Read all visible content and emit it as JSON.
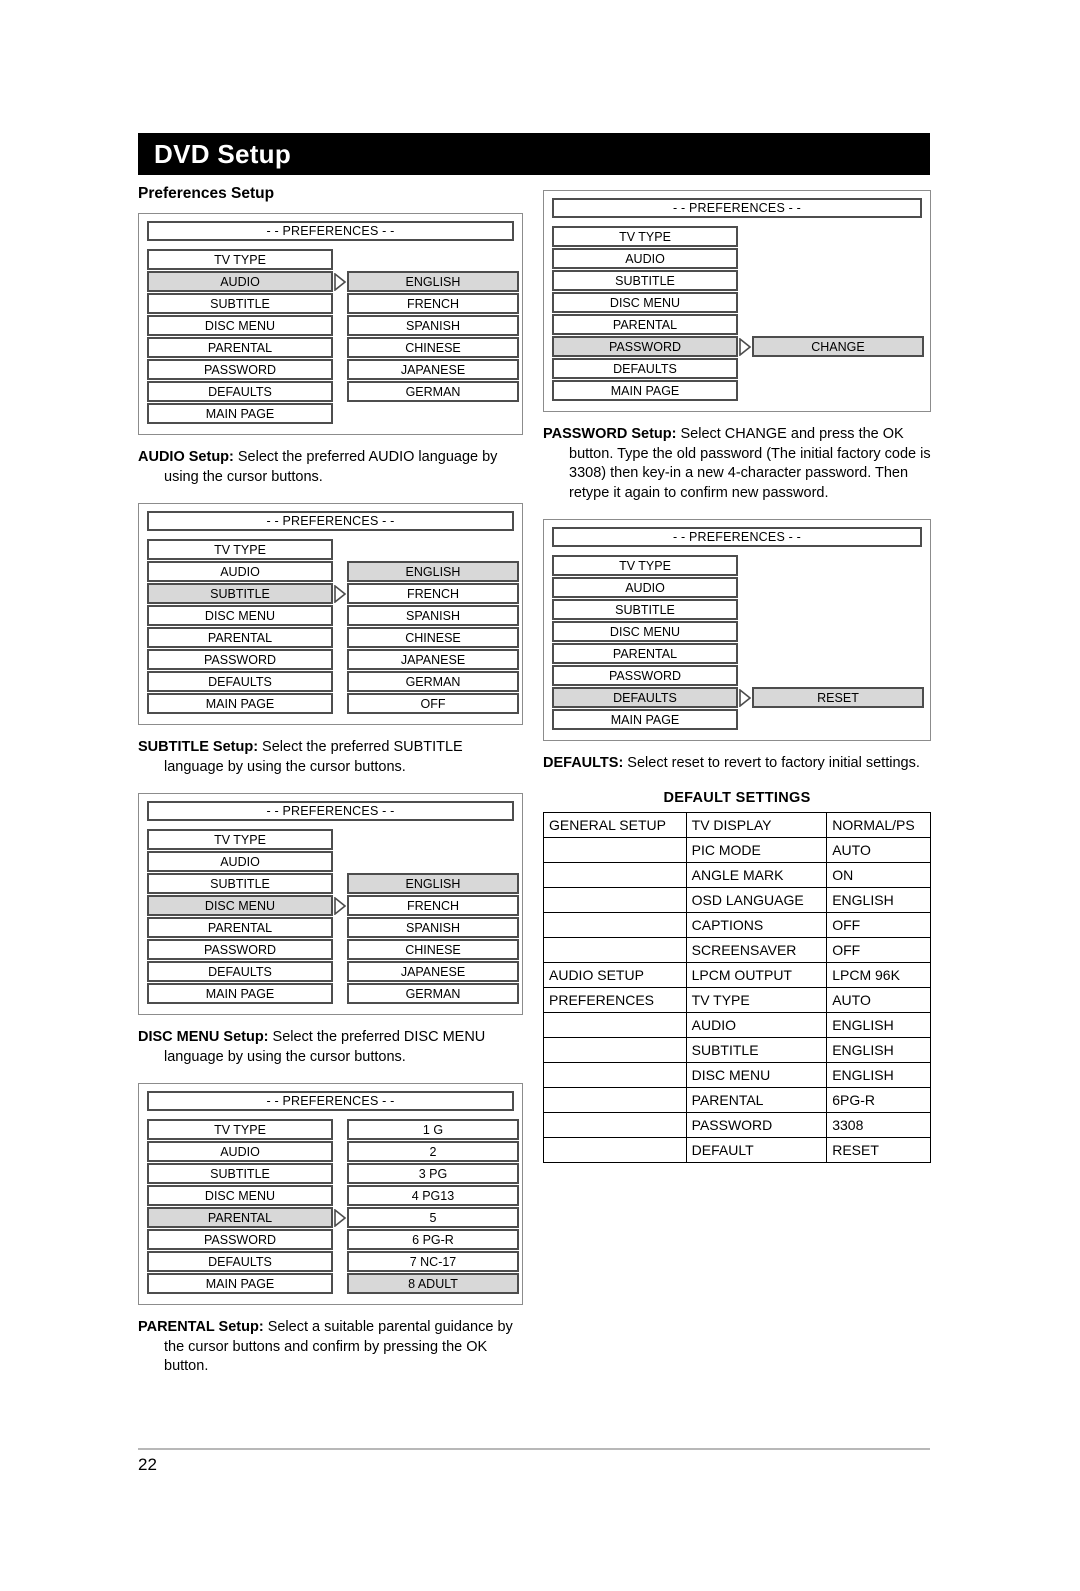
{
  "header": {
    "title": "DVD Setup"
  },
  "left_column": {
    "section_title": "Preferences Setup",
    "diagrams": [
      {
        "name": "audio-setup-diagram",
        "menu_title": "- - PREFERENCES - -",
        "left_items": [
          "TV TYPE",
          "AUDIO",
          "SUBTITLE",
          "DISC MENU",
          "PARENTAL",
          "PASSWORD",
          "DEFAULTS",
          "MAIN PAGE"
        ],
        "left_selected": "AUDIO",
        "right_offset_rows": 1,
        "right_items": [
          "ENGLISH",
          "FRENCH",
          "SPANISH",
          "CHINESE",
          "JAPANESE",
          "GERMAN"
        ],
        "right_selected": "ENGLISH",
        "caption_bold": "AUDIO Setup:",
        "caption_text": " Select the preferred AUDIO language by using the cursor buttons."
      },
      {
        "name": "subtitle-setup-diagram",
        "menu_title": "- - PREFERENCES - -",
        "left_items": [
          "TV TYPE",
          "AUDIO",
          "SUBTITLE",
          "DISC MENU",
          "PARENTAL",
          "PASSWORD",
          "DEFAULTS",
          "MAIN PAGE"
        ],
        "left_selected": "SUBTITLE",
        "right_offset_rows": 1,
        "right_items": [
          "ENGLISH",
          "FRENCH",
          "SPANISH",
          "CHINESE",
          "JAPANESE",
          "GERMAN",
          "OFF"
        ],
        "right_selected": "ENGLISH",
        "caption_bold": "SUBTITLE Setup:",
        "caption_text": " Select the preferred SUBTITLE language by using the cursor buttons."
      },
      {
        "name": "disc-menu-setup-diagram",
        "menu_title": "- - PREFERENCES - -",
        "left_items": [
          "TV TYPE",
          "AUDIO",
          "SUBTITLE",
          "DISC MENU",
          "PARENTAL",
          "PASSWORD",
          "DEFAULTS",
          "MAIN PAGE"
        ],
        "left_selected": "DISC MENU",
        "right_offset_rows": 2,
        "right_items": [
          "ENGLISH",
          "FRENCH",
          "SPANISH",
          "CHINESE",
          "JAPANESE",
          "GERMAN"
        ],
        "right_selected": "ENGLISH",
        "caption_bold": "DISC MENU Setup:",
        "caption_text": " Select the preferred DISC MENU language by using the cursor buttons."
      },
      {
        "name": "parental-setup-diagram",
        "menu_title": "- - PREFERENCES - -",
        "left_items": [
          "TV TYPE",
          "AUDIO",
          "SUBTITLE",
          "DISC MENU",
          "PARENTAL",
          "PASSWORD",
          "DEFAULTS",
          "MAIN PAGE"
        ],
        "left_selected": "PARENTAL",
        "right_offset_rows": 0,
        "right_items": [
          "1 G",
          "2",
          "3 PG",
          "4 PG13",
          "5",
          "6 PG-R",
          "7 NC-17",
          "8 ADULT"
        ],
        "right_selected": "8 ADULT",
        "caption_bold": "PARENTAL Setup:",
        "caption_text": " Select a suitable parental guidance by the cursor buttons and confirm by pressing the OK button."
      }
    ]
  },
  "right_column": {
    "diagrams": [
      {
        "name": "password-setup-diagram",
        "menu_title": "- - PREFERENCES - -",
        "left_items": [
          "TV TYPE",
          "AUDIO",
          "SUBTITLE",
          "DISC MENU",
          "PARENTAL",
          "PASSWORD",
          "DEFAULTS",
          "MAIN PAGE"
        ],
        "left_selected": "PASSWORD",
        "right_offset_rows": 5,
        "right_items": [
          "CHANGE"
        ],
        "right_selected": "CHANGE",
        "caption_bold": "PASSWORD Setup:",
        "caption_text": " Select CHANGE and press the OK button. Type the old password (The initial factory code is 3308) then key-in a new 4-character password. Then retype it again to confirm new password."
      },
      {
        "name": "defaults-setup-diagram",
        "menu_title": "- - PREFERENCES - -",
        "left_items": [
          "TV TYPE",
          "AUDIO",
          "SUBTITLE",
          "DISC MENU",
          "PARENTAL",
          "PASSWORD",
          "DEFAULTS",
          "MAIN PAGE"
        ],
        "left_selected": "DEFAULTS",
        "right_offset_rows": 6,
        "right_items": [
          "RESET"
        ],
        "right_selected": "RESET",
        "caption_bold": "DEFAULTS:",
        "caption_text": " Select reset to revert to factory initial settings."
      }
    ],
    "default_settings": {
      "heading": "DEFAULT SETTINGS",
      "rows": [
        {
          "group": "GENERAL SETUP",
          "item": "TV DISPLAY",
          "value": "NORMAL/PS"
        },
        {
          "group": "",
          "item": "PIC MODE",
          "value": "AUTO"
        },
        {
          "group": "",
          "item": "ANGLE MARK",
          "value": "ON"
        },
        {
          "group": "",
          "item": "OSD LANGUAGE",
          "value": "ENGLISH"
        },
        {
          "group": "",
          "item": "CAPTIONS",
          "value": "OFF"
        },
        {
          "group": "",
          "item": "SCREENSAVER",
          "value": "OFF"
        },
        {
          "group": "AUDIO SETUP",
          "item": "LPCM OUTPUT",
          "value": "LPCM 96K"
        },
        {
          "group": "PREFERENCES",
          "item": "TV TYPE",
          "value": "AUTO"
        },
        {
          "group": "",
          "item": "AUDIO",
          "value": "ENGLISH"
        },
        {
          "group": "",
          "item": "SUBTITLE",
          "value": "ENGLISH"
        },
        {
          "group": "",
          "item": "DISC MENU",
          "value": "ENGLISH"
        },
        {
          "group": "",
          "item": "PARENTAL",
          "value": "6PG-R"
        },
        {
          "group": "",
          "item": "PASSWORD",
          "value": "3308"
        },
        {
          "group": "",
          "item": "DEFAULT",
          "value": "RESET"
        }
      ]
    }
  },
  "footer": {
    "page_number": "22"
  },
  "colors": {
    "selected_row": "#d8d8d8",
    "row_border": "#4d4d4d",
    "frame_border": "#8c8c8c",
    "header_bar": "#000000",
    "footer_rule": "#b8b8b8"
  }
}
